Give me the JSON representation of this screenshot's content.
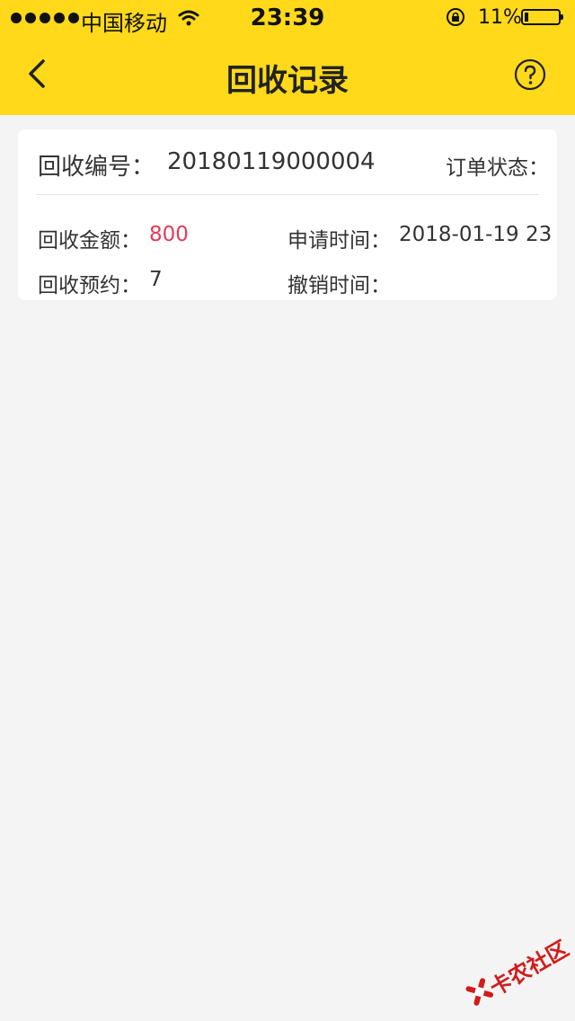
{
  "status_bar": {
    "carrier": "中国移动",
    "time": "23:39",
    "battery_percent": "11%",
    "battery_level": 0.11,
    "icons": [
      "signal-dots-icon",
      "wifi-icon",
      "rotation-lock-icon",
      "battery-icon"
    ]
  },
  "nav": {
    "title": "回收记录",
    "back_icon": "chevron-left-icon",
    "help_icon": "question-circle-icon"
  },
  "record": {
    "recycle_no_label": "回收编号：",
    "recycle_no": "20180119000004",
    "status_label": "订单状态：",
    "amount_label": "回收金额：",
    "amount": "800",
    "apply_time_label": "申请时间：",
    "apply_time": "2018-01-19 23",
    "reserve_label": "回收预约：",
    "reserve": "7",
    "cancel_time_label": "撤销时间："
  },
  "watermark": {
    "text": "卡农社区"
  },
  "colors": {
    "header_bg": "#ffd91a",
    "page_bg": "#f4f4f4",
    "card_bg": "#ffffff",
    "amount": "#e5395b",
    "watermark": "#d21b1b"
  }
}
